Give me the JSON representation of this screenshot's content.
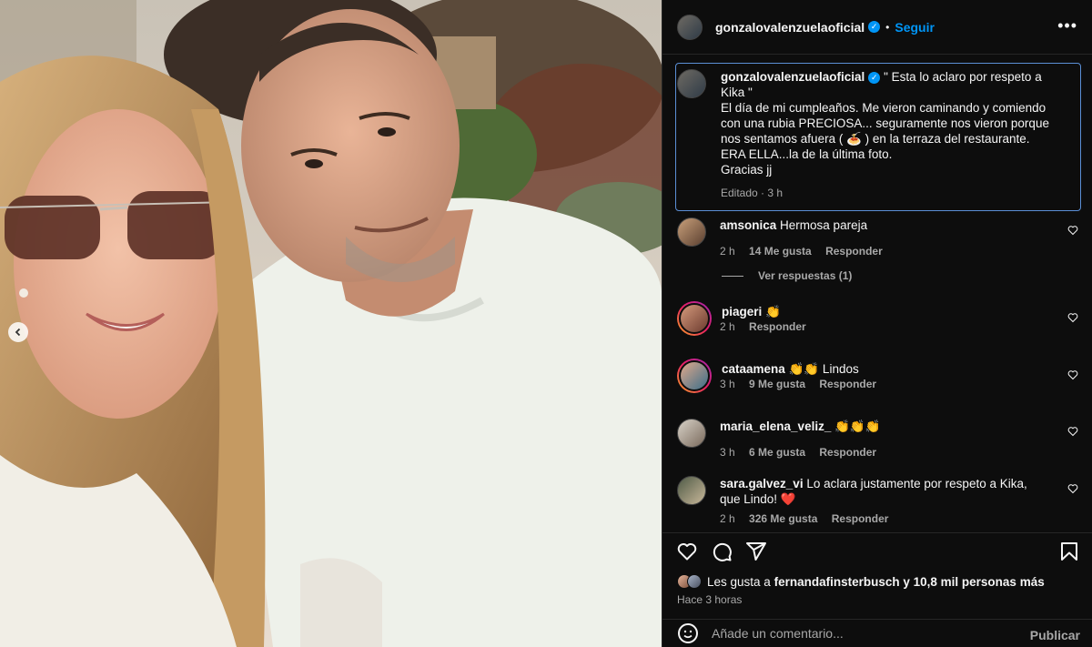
{
  "post": {
    "username": "gonzalovalenzuelaoficial",
    "follow_label": "Seguir",
    "dot": "•",
    "more_label": "•••"
  },
  "caption": {
    "username": "gonzalovalenzuelaoficial",
    "line1": "\" Esta lo aclaro por respeto a Kika \"",
    "line2": "El día de mi cumpleaños. Me vieron caminando y comiendo con una rubia PRECIOSA... seguramente nos vieron porque nos sentamos afuera ( 🍝 ) en la terraza del restaurante.",
    "line3": "ERA ELLA...la de la última foto.",
    "line4": "Gracias jj",
    "meta": "Editado · 3 h"
  },
  "comments": [
    {
      "user": "amsonica",
      "text": "Hermosa pareja",
      "time": "2 h",
      "likes": "14 Me gusta",
      "reply": "Responder"
    },
    {
      "user": "piageri",
      "text": "👏",
      "time": "2 h",
      "likes": "",
      "reply": "Responder"
    },
    {
      "user": "cataamena",
      "text": "👏👏 Lindos",
      "time": "3 h",
      "likes": "9 Me gusta",
      "reply": "Responder"
    },
    {
      "user": "maria_elena_veliz_",
      "text": "👏👏👏",
      "time": "3 h",
      "likes": "6 Me gusta",
      "reply": "Responder"
    },
    {
      "user": "sara.galvez_vi",
      "text": "Lo aclara justamente por respeto a Kika, que Lindo! ❤️",
      "time": "2 h",
      "likes": "326 Me gusta",
      "reply": "Responder"
    }
  ],
  "replies_label": "Ver respuestas (1)",
  "likes": {
    "prefix": "Les gusta a",
    "user": "fernandafinsterbusch",
    "suffix": "y 10,8 mil personas más"
  },
  "post_time": "Hace 3 horas",
  "add_comment": {
    "placeholder": "Añade un comentario...",
    "publish_label": "Publicar"
  },
  "icons": {
    "like": "heart-icon",
    "comment": "comment-icon",
    "share": "share-icon",
    "save": "bookmark-icon",
    "emoji": "emoji-icon",
    "prev": "chevron-left-icon"
  },
  "colors": {
    "accent": "#0095f6",
    "background": "#0d0d0d",
    "muted": "#a8a8a8",
    "highlight_border": "#5b8fd6",
    "heart": "#ed4956"
  }
}
